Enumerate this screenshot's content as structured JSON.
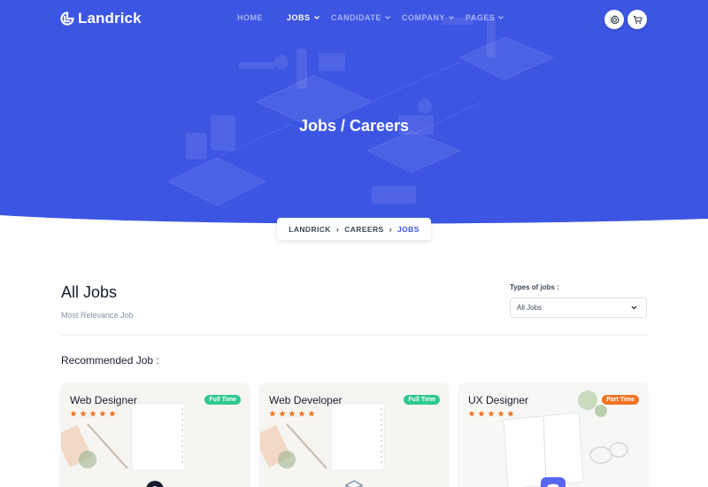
{
  "brand": {
    "name": "Landrick"
  },
  "nav": {
    "items": [
      {
        "label": "HOME",
        "dropdown": false,
        "active": false
      },
      {
        "label": "JOBS",
        "dropdown": true,
        "active": true
      },
      {
        "label": "CANDIDATE",
        "dropdown": true,
        "active": false
      },
      {
        "label": "COMPANY",
        "dropdown": true,
        "active": false
      },
      {
        "label": "PAGES",
        "dropdown": true,
        "active": false
      }
    ],
    "icons": [
      "gear-icon",
      "cart-icon"
    ]
  },
  "hero": {
    "title": "Jobs / Careers"
  },
  "breadcrumb": {
    "items": [
      "LANDRICK",
      "CAREERS",
      "JOBS"
    ],
    "separator": "›"
  },
  "section": {
    "title": "All Jobs",
    "subtitle": "Most Relevance Job",
    "filter_label": "Types of jobs :",
    "filter_value": "All Jobs",
    "recommended_title": "Recommended Job :"
  },
  "jobs": [
    {
      "title": "Web Designer",
      "badge": "Full Time",
      "badge_color": "#2eca8b",
      "rating": 5,
      "logo_icon": "circle-logo-icon"
    },
    {
      "title": "Web Developer",
      "badge": "Full Time",
      "badge_color": "#2eca8b",
      "rating": 5,
      "logo_icon": "cube-logo-icon"
    },
    {
      "title": "UX Designer",
      "badge": "Part Time",
      "badge_color": "#f17425",
      "rating": 5,
      "logo_icon": "discord-logo-icon"
    }
  ],
  "colors": {
    "primary": "#3c55e3",
    "star": "#f17425",
    "success": "#2eca8b",
    "warning": "#f17425"
  }
}
